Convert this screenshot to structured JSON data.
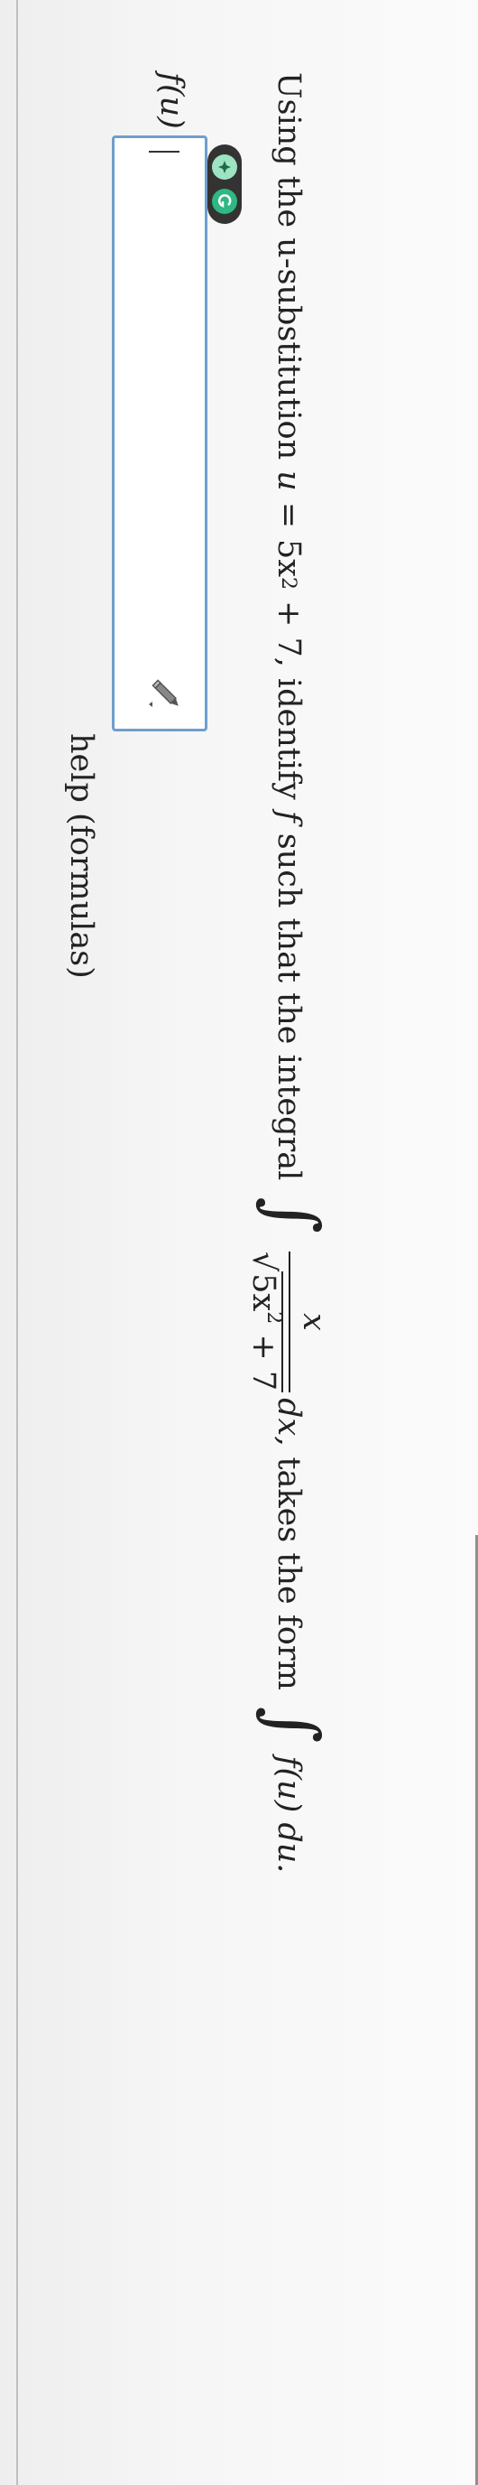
{
  "question": {
    "prefix": "Using the u-substitution",
    "u_var": "u",
    "eq": "=",
    "sub_base": "5x",
    "sub_exp": "2",
    "sub_tail": "+ 7,",
    "mid": "identify",
    "f_var": "f",
    "mid2": "such that the integral",
    "integral_sign": "∫",
    "frac_num": "x",
    "sqrt_sign": "√",
    "radicand_base": "5x",
    "radicand_exp": "2",
    "radicand_tail": "+ 7",
    "dx": "dx,",
    "takes_form": "takes the form",
    "integral_sign_2": "∫",
    "form_expr": "f(u) du."
  },
  "answer": {
    "label": "f(u) =",
    "value": ""
  },
  "help_link": "help (formulas)",
  "icons": {
    "pencil": "pencil-icon",
    "badge_left": "sparkle-icon",
    "badge_right": "grammar-check-icon"
  },
  "colors": {
    "input_border": "#6e9fcc",
    "badge_bg": "#333333",
    "badge_green": "#2fb784"
  }
}
